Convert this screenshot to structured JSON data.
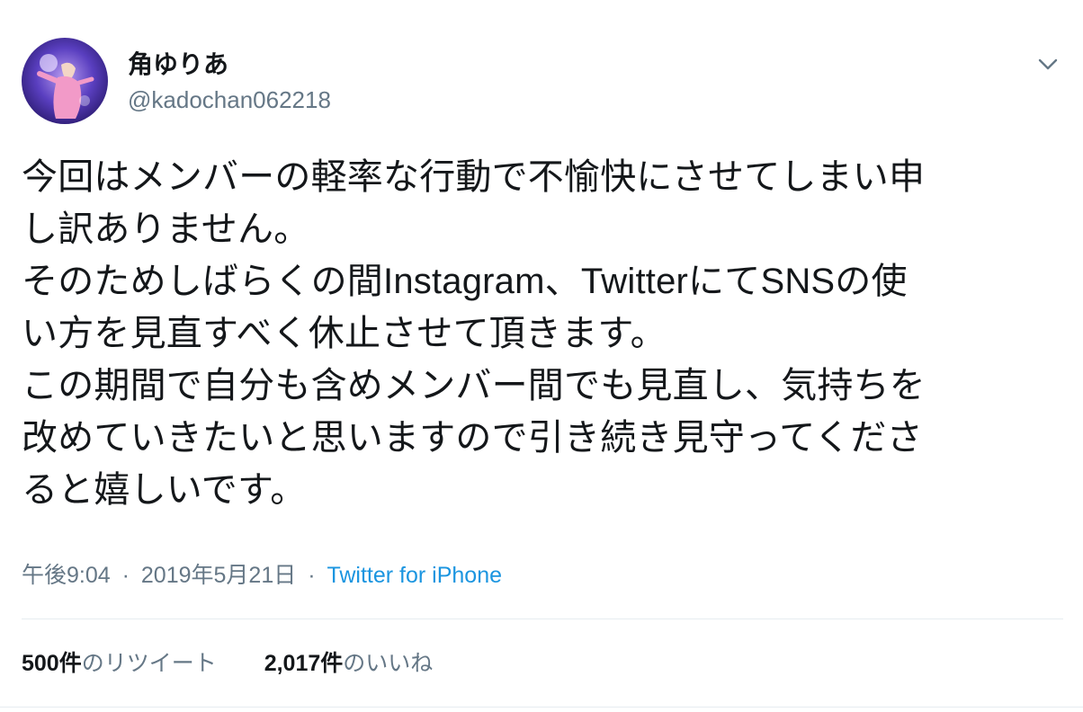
{
  "author": {
    "display_name": "角ゆりあ",
    "handle": "@kadochan062218",
    "avatar": "user-avatar-photo"
  },
  "menu_icon": "chevron-down-icon",
  "tweet": {
    "lines": [
      "今回はメンバーの軽率な行動で不愉快にさせてしまい申",
      "し訳ありません。",
      "そのためしばらくの間Instagram、TwitterにてSNSの使",
      "い方を見直すべく休止させて頂きます。",
      "この期間で自分も含めメンバー間でも見直し、気持ちを",
      "改めていきたいと思いますので引き続き見守ってくださ",
      "ると嬉しいです。"
    ]
  },
  "meta": {
    "time": "午後9:04",
    "separator": "·",
    "date": "2019年5月21日",
    "source": "Twitter for iPhone"
  },
  "stats": {
    "retweets": {
      "count": "500件",
      "label": "のリツイート"
    },
    "likes": {
      "count": "2,017件",
      "label": "のいいね"
    }
  },
  "colors": {
    "text": "#14171a",
    "secondary": "#657786",
    "link": "#1b95e0",
    "divider": "#e6ecf0"
  }
}
